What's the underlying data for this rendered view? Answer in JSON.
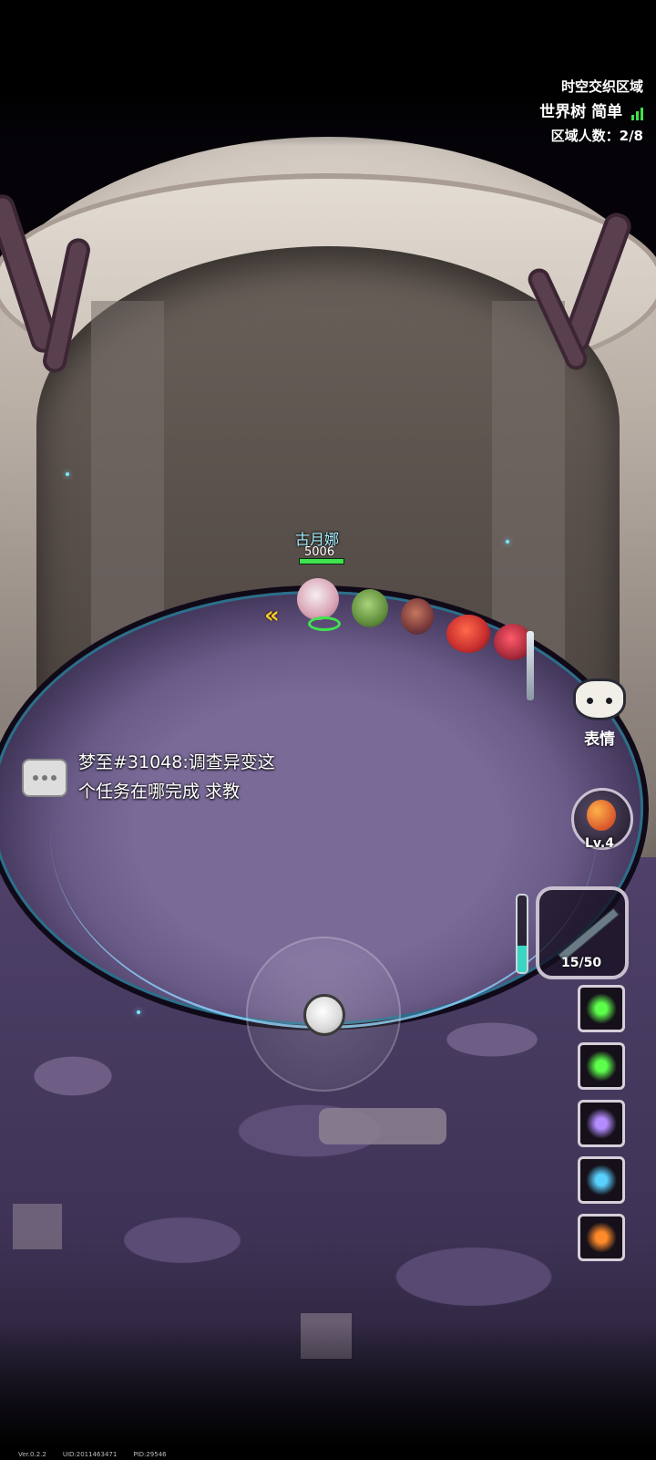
{
  "zone": {
    "title": "时空交织区域",
    "map_name": "世界树",
    "difficulty": "简单",
    "player_count": "区域人数：2/8"
  },
  "player": {
    "name": "古月娜",
    "power": "5006",
    "hp_fraction": 1.0
  },
  "chat": {
    "message_line1": "梦至#31048:调查异变这",
    "message_line2": "个任务在哪完成 求教"
  },
  "buttons": {
    "emote_label": "表情",
    "potion_level": "Lv.4",
    "weapon_ammo": "15/50",
    "charge_fraction": 0.35
  },
  "skills": [
    {
      "icon": "green-burst-icon",
      "color": "#5cff4a"
    },
    {
      "icon": "green-burst-icon",
      "color": "#5cff4a"
    },
    {
      "icon": "void-orb-icon",
      "color": "#b48cff"
    },
    {
      "icon": "ice-dash-icon",
      "color": "#5ad0ff"
    },
    {
      "icon": "fire-ring-icon",
      "color": "#ff8a2a"
    }
  ],
  "footer": {
    "version": "Ver.0.2.2",
    "uid": "UID:2011463471",
    "pid": "PID:29546"
  }
}
